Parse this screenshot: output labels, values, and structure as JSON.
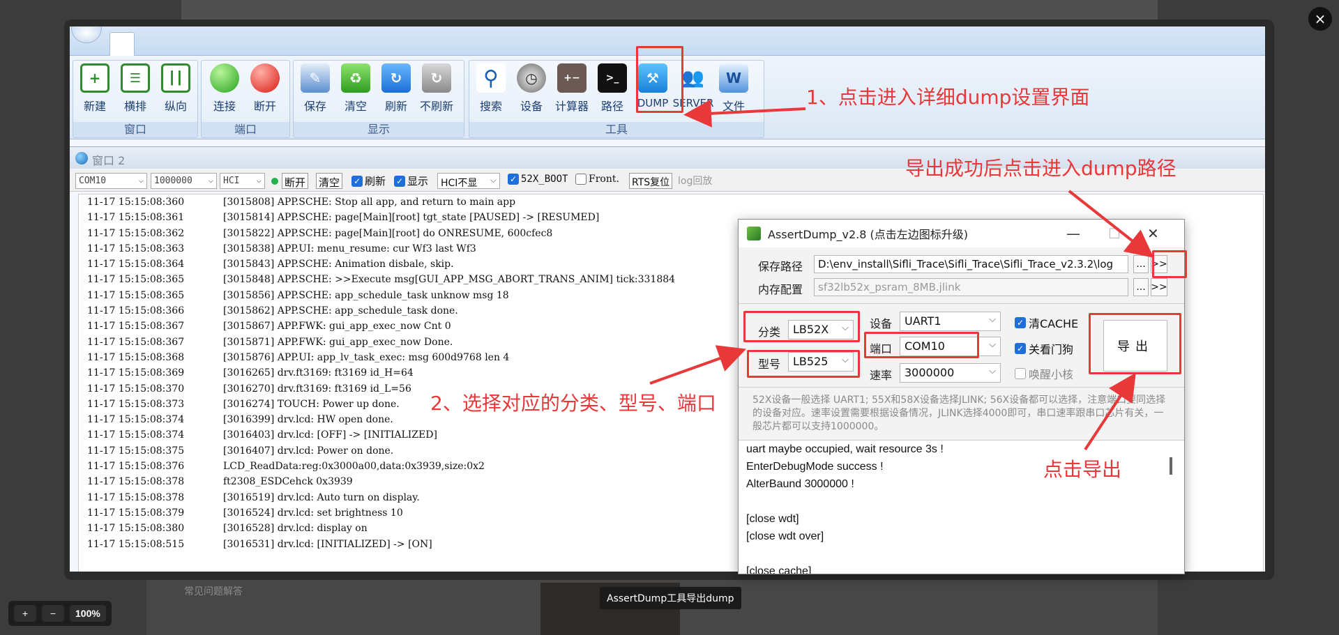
{
  "ribbon": {
    "groups": [
      {
        "label": "窗口",
        "buttons": [
          "新建",
          "横排",
          "纵向"
        ]
      },
      {
        "label": "端口",
        "buttons": [
          "连接",
          "断开"
        ]
      },
      {
        "label": "显示",
        "buttons": [
          "保存",
          "清空",
          "刷新",
          "不刷新"
        ]
      },
      {
        "label": "工具",
        "buttons": [
          "搜索",
          "设备",
          "计算器",
          "路径",
          "DUMP",
          "SERVER",
          "文件"
        ]
      }
    ]
  },
  "window": {
    "title": "窗口 2"
  },
  "toolbar": {
    "port": "COM10",
    "baud": "1000000",
    "mode": "HCI",
    "disconnect": "断开",
    "clear": "清空",
    "refresh": "刷新",
    "show": "显示",
    "hci_hide": "HCI不显",
    "boot": "52X_BOOT",
    "front": "Front.",
    "rts": "RTS复位",
    "log_replay": "log回放"
  },
  "log": [
    [
      "11-17 15:15:08:360",
      "[3015808] APP.SCHE: Stop all app, and return to main app"
    ],
    [
      "11-17 15:15:08:361",
      "[3015814] APP.SCHE: page[Main][root] tgt_state [PAUSED] -> [RESUMED]"
    ],
    [
      "11-17 15:15:08:362",
      "[3015822] APP.SCHE: page[Main][root] do ONRESUME, 600cfec8"
    ],
    [
      "11-17 15:15:08:363",
      "[3015838] APP.UI: menu_resume: cur Wf3 last Wf3"
    ],
    [
      "11-17 15:15:08:364",
      "[3015843] APP.SCHE: Animation disbale, skip."
    ],
    [
      "11-17 15:15:08:365",
      "[3015848] APP.SCHE: >>Execute msg[GUI_APP_MSG_ABORT_TRANS_ANIM] tick:331884"
    ],
    [
      "11-17 15:15:08:365",
      "[3015856] APP.SCHE: app_schedule_task unknow msg 18"
    ],
    [
      "11-17 15:15:08:366",
      "[3015862] APP.SCHE: app_schedule_task done."
    ],
    [
      "11-17 15:15:08:367",
      "[3015867] APP.FWK: gui_app_exec_now Cnt 0"
    ],
    [
      "11-17 15:15:08:367",
      "[3015871] APP.FWK: gui_app_exec_now Done."
    ],
    [
      "11-17 15:15:08:368",
      "[3015876] APP.UI: app_lv_task_exec: msg 600d9768 len 4"
    ],
    [
      "11-17 15:15:08:369",
      "[3016265] drv.ft3169: ft3169 id_H=64"
    ],
    [
      "11-17 15:15:08:370",
      "[3016270] drv.ft3169: ft3169 id_L=56"
    ],
    [
      "11-17 15:15:08:373",
      "[3016274] TOUCH: Power up done."
    ],
    [
      "11-17 15:15:08:374",
      "[3016399] drv.lcd: HW open done."
    ],
    [
      "11-17 15:15:08:374",
      "[3016403] drv.lcd: [OFF] -> [INITIALIZED]"
    ],
    [
      "11-17 15:15:08:375",
      "[3016407] drv.lcd: Power on done."
    ],
    [
      "11-17 15:15:08:376",
      "LCD_ReadData:reg:0x3000a00,data:0x3939,size:0x2"
    ],
    [
      "11-17 15:15:08:378",
      "ft2308_ESDCehck 0x3939"
    ],
    [
      "11-17 15:15:08:378",
      "[3016519] drv.lcd: Auto turn on display."
    ],
    [
      "11-17 15:15:08:379",
      "[3016524] drv.lcd: set brightness 10"
    ],
    [
      "11-17 15:15:08:380",
      "[3016528] drv.lcd: display on"
    ],
    [
      "11-17 15:15:08:515",
      "[3016531] drv.lcd: [INITIALIZED] -> [ON]"
    ]
  ],
  "dialog": {
    "title": "AssertDump_v2.8 (点击左边图标升级)",
    "save_path_label": "保存路径",
    "save_path": "D:\\env_install\\Sifli_Trace\\Sifli_Trace\\Sifli_Trace_v2.3.2\\log",
    "mem_label": "内存配置",
    "mem_value": "sf32lb52x_psram_8MB.jlink",
    "dots": "...",
    "go": ">>",
    "category_label": "分类",
    "category": "LB52X",
    "model_label": "型号",
    "model": "LB525",
    "device_label": "设备",
    "device": "UART1",
    "port_label": "端口",
    "port": "COM10",
    "rate_label": "速率",
    "rate": "3000000",
    "clear_cache": "清CACHE",
    "close_wdt": "关看门狗",
    "wake_core": "唤醒小核",
    "export": "导出",
    "hint": "52X设备一般选择 UART1; 55X和58X设备选择JLINK; 56X设备都可以选择，注意端口要同选择的设备对应。速率设置需要根据设备情况，JLINK选择4000即可，串口速率跟串口芯片有关，一般芯片都可以支持1000000。",
    "output": [
      "uart maybe occupied, wait resource 3s !",
      "EnterDebugMode success !",
      "AlterBaund 3000000 !",
      "",
      "[close wdt]",
      "[close wdt over]",
      "",
      "[close cache]"
    ]
  },
  "annotations": {
    "step1": "1、点击进入详细dump设置界面",
    "path_hint": "导出成功后点击进入dump路径",
    "step2": "2、选择对应的分类、型号、端口",
    "export_hint": "点击导出"
  },
  "viewer": {
    "caption": "AssertDump工具导出dump",
    "zoom_in": "+",
    "zoom_out": "−",
    "zoom": "100%",
    "close": "×",
    "bg_faq": "常见问题解答"
  },
  "colors": {
    "annotation": "#e8383a",
    "ribbon_text": "#1d3f73"
  }
}
